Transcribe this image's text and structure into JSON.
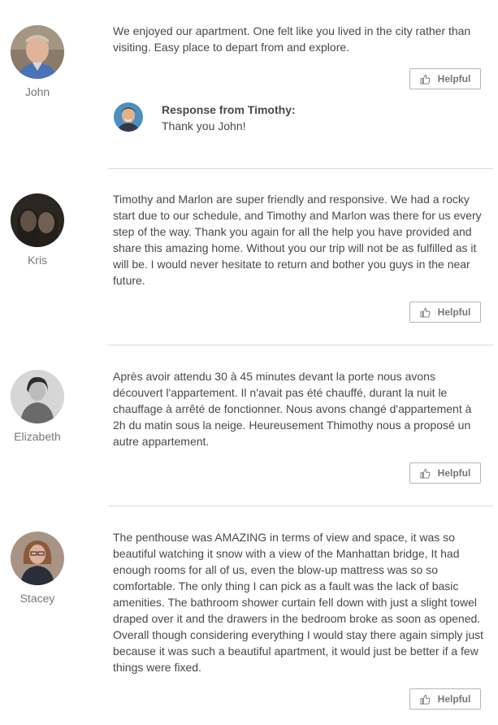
{
  "reviews": [
    {
      "name": "John",
      "text": "We enjoyed our apartment. One felt like you lived in the city rather than visiting. Easy place to depart from and explore.",
      "helpful_label": "Helpful",
      "response": {
        "title": "Response from Timothy:",
        "body": "Thank you John!"
      }
    },
    {
      "name": "Kris",
      "text": "Timothy and Marlon are super friendly and responsive. We had a rocky start due to our schedule, and Timothy and Marlon was there for us every step of the way. Thank you again for all the help you have provided and share this amazing home. Without you our trip will not be as fulfilled as it will be. I would never hesitate to return and bother you guys in the near future.",
      "helpful_label": "Helpful"
    },
    {
      "name": "Elizabeth",
      "text": "Après avoir attendu 30 à 45 minutes devant la porte nous avons découvert l'appartement. Il n'avait pas été chauffé, durant la nuit le chauffage à arrêté de fonctionner. Nous avons changé d'appartement à 2h du matin sous la neige. Heureusement Thimothy nous a proposé un autre appartement.",
      "helpful_label": "Helpful"
    },
    {
      "name": "Stacey",
      "text": "The penthouse was AMAZING in terms of view and space, it was so beautiful watching it snow with a view of the Manhattan bridge, It had enough rooms for all of us, even the blow-up mattress was so so comfortable. The only thing I can pick as a fault was the lack of basic amenities. The bathroom shower curtain fell down with just a slight towel draped over it and the drawers in the bedroom broke as soon as opened. Overall though considering everything I would stay there again simply just because it was such a beautiful apartment, it would just be better if a few things were fixed.",
      "helpful_label": "Helpful"
    }
  ],
  "icons": {
    "helpful": "thumbs-up-icon",
    "avatar": "avatar-photo"
  },
  "colors": {
    "text": "#484848",
    "muted": "#767676",
    "border": "#b4b4b4",
    "divider": "#dcdcdc"
  }
}
